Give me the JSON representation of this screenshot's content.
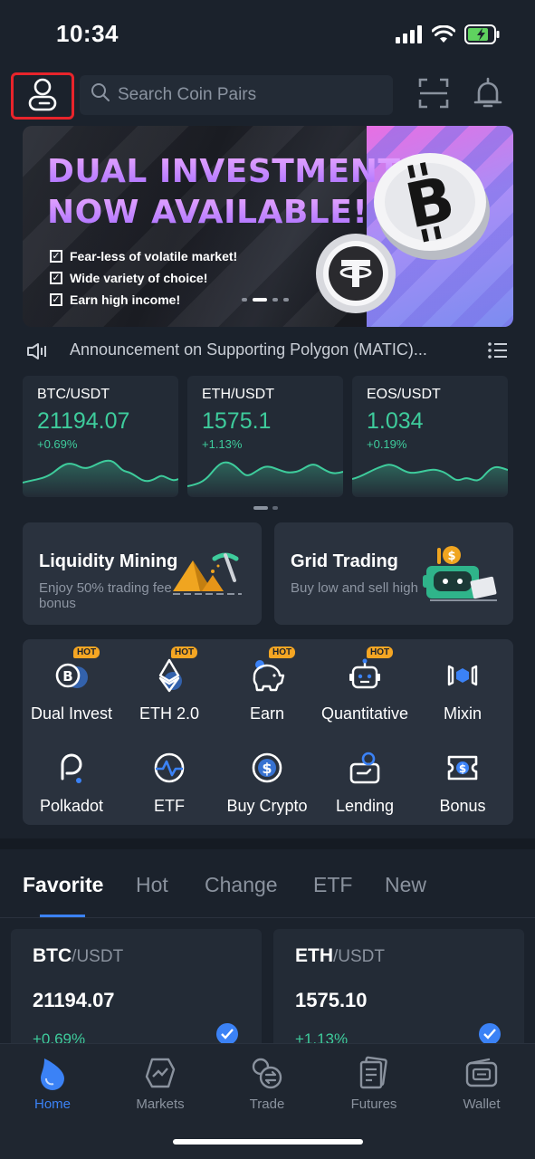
{
  "status_bar": {
    "time": "10:34"
  },
  "header": {
    "search_placeholder": "Search Coin Pairs"
  },
  "banner": {
    "title_line1": "DUAL INVESTMENT",
    "title_line2": "NOW AVAILABLE!",
    "bullets": [
      "Fear-less of volatile market!",
      "Wide variety of choice!",
      "Earn high income!"
    ]
  },
  "announcement": {
    "text": "Announcement on Supporting Polygon (MATIC)..."
  },
  "tickers": [
    {
      "pair": "BTC/USDT",
      "price": "21194.07",
      "change": "+0.69%"
    },
    {
      "pair": "ETH/USDT",
      "price": "1575.1",
      "change": "+1.13%"
    },
    {
      "pair": "EOS/USDT",
      "price": "1.034",
      "change": "+0.19%"
    }
  ],
  "feature_cards": [
    {
      "title": "Liquidity Mining",
      "subtitle": "Enjoy 50% trading fee bonus"
    },
    {
      "title": "Grid Trading",
      "subtitle": "Buy low and sell high"
    }
  ],
  "services": [
    {
      "label": "Dual Invest",
      "badge": "HOT",
      "icon": "dual-invest-icon"
    },
    {
      "label": "ETH 2.0",
      "badge": "HOT",
      "icon": "ethereum-icon"
    },
    {
      "label": "Earn",
      "badge": "HOT",
      "icon": "piggy-bank-icon"
    },
    {
      "label": "Quantitative",
      "badge": "HOT",
      "icon": "robot-icon"
    },
    {
      "label": "Mixin",
      "badge": "",
      "icon": "mixin-icon"
    },
    {
      "label": "Polkadot",
      "badge": "",
      "icon": "polkadot-icon"
    },
    {
      "label": "ETF",
      "badge": "",
      "icon": "etf-icon"
    },
    {
      "label": "Buy Crypto",
      "badge": "",
      "icon": "buy-crypto-icon"
    },
    {
      "label": "Lending",
      "badge": "",
      "icon": "lending-icon"
    },
    {
      "label": "Bonus",
      "badge": "",
      "icon": "bonus-icon"
    }
  ],
  "market_tabs": [
    "Favorite",
    "Hot",
    "Change",
    "ETF",
    "New"
  ],
  "active_market_tab": "Favorite",
  "market_cards": [
    {
      "base": "BTC",
      "quote": "/USDT",
      "price": "21194.07",
      "change": "+0.69%"
    },
    {
      "base": "ETH",
      "quote": "/USDT",
      "price": "1575.10",
      "change": "+1.13%"
    }
  ],
  "bottom_nav": [
    {
      "label": "Home",
      "icon": "home-icon"
    },
    {
      "label": "Markets",
      "icon": "markets-icon"
    },
    {
      "label": "Trade",
      "icon": "trade-icon"
    },
    {
      "label": "Futures",
      "icon": "futures-icon"
    },
    {
      "label": "Wallet",
      "icon": "wallet-icon"
    }
  ],
  "active_nav": "Home",
  "colors": {
    "background": "#1b222c",
    "positive": "#3ecc9c",
    "accent": "#3b82f6",
    "hot_badge": "#f5a623",
    "highlight_border": "#e8242b"
  }
}
